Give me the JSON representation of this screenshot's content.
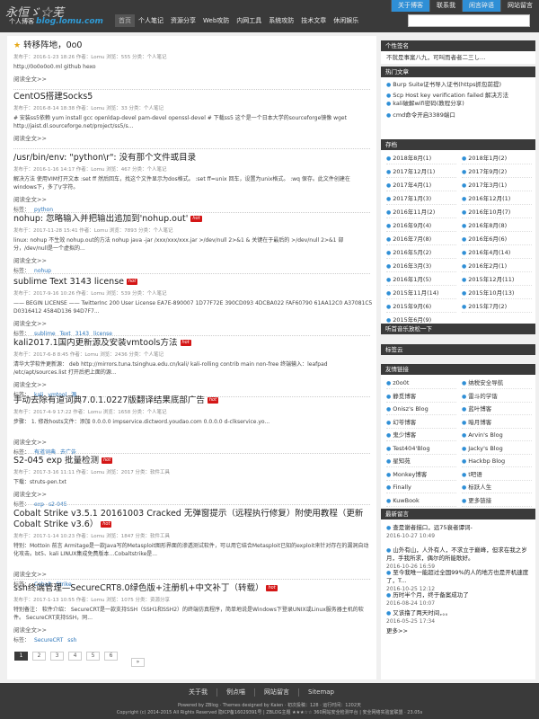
{
  "site": {
    "logo_main": "永恒ゞ☆芜",
    "logo_sub": "个人博客",
    "logo_domain": "blog.lomu.com"
  },
  "top_nav": [
    "关于博客",
    "联系我",
    "闲言碎语",
    "网站留言"
  ],
  "main_nav": [
    "首页",
    "个人笔记",
    "资源分享",
    "Web攻防",
    "内网工具",
    "系统攻防",
    "技术文章",
    "休闲娱乐"
  ],
  "search": {
    "placeholder": ""
  },
  "posts": [
    {
      "title": "转移阵地，0o0",
      "sticky": true,
      "hot": false,
      "meta": "发布于：2016-1-23 18:26  作者：Lomu  浏览：555  分类：个人笔记",
      "excerpt": "http://0o0o0o0.ml github          hexo",
      "more": "阅读全文>>",
      "tags": []
    },
    {
      "title": "CentOS搭建Socks5",
      "hot": false,
      "meta": "发布于：2016-8-14 18:38  作者：Lomu  浏览：33  分类：个人笔记",
      "excerpt": "# 安装ss5依赖 yum install gcc openldap-devel pam-devel openssl-devel # 下载ss5 这个是一个日本大学的sourceforge镜像 wget http://jaist.dl.sourceforge.net/project/ss5/s...",
      "more": "阅读全文>>",
      "tags": []
    },
    {
      "title": "/usr/bin/env: \"python\\r\": 没有那个文件或目录",
      "hot": false,
      "meta": "发布于：2016-1-16 14:17  作者：Lomu  浏览：467  分类：个人笔记",
      "excerpt": "解决方法 使用VIM打开文本  :set ff 然后回车，找这个文件显示为dos格式。  :set ff=unix 回车，设置为unix格式。  :wq 保存。此文件创建在windows下，多了\\r字符。",
      "more": "阅读全文>>",
      "tags": [
        "python"
      ]
    },
    {
      "title": "nohup: 忽略输入并把输出追加到'nohup.out'",
      "hot": true,
      "meta": "发布于：2017-11-28 15:41  作者：Lomu  浏览：7893  分类：个人笔记",
      "excerpt": "linux: nohup 不生效 nohup.out的方法 nohup java -jar /xxx/xxx/xxx.jar >/dev/null 2>&1 & 关键在于最后的 >/dev/null 2>&1 部分，/dev/null是一个虚拟的...",
      "more": "阅读全文>>",
      "tags": [
        "nohup"
      ]
    },
    {
      "title": "sublime Text 3143 license",
      "hot": true,
      "meta": "发布于：2017-9-16 10:26  作者：Lomu  浏览：539  分类：个人笔记",
      "excerpt": "—— BEGIN LICENSE —— TwitterInc 200 User License EA7E-890007 1D77F72E 390CD093 4DCBA022 FAF60790 61AA12C0 A37081C5 D0316412 4584D136 94D7F7...",
      "more": "阅读全文>>",
      "tags": [
        "sublime",
        "Text",
        "3143",
        "license"
      ]
    },
    {
      "title": "kali2017.1国内更新源及安装vmtools方法",
      "hot": true,
      "meta": "发布于：2017-6-8 8:45  作者：Lomu  浏览：2436  分类：个人笔记",
      "excerpt": "清华大学软件更新源： deb http://mirrors.tuna.tsinghua.edu.cn/kali/  kali-rolling contrib main non-free 终端输入：leafpad /etc/apt/sources.list 打开后把上面的源...",
      "more": "阅读全文>>",
      "tags": [
        "kali",
        "vmtool",
        "源"
      ]
    },
    {
      "title": "手动去除有道词典7.0.1.0227版翻译结果底部广告",
      "hot": true,
      "meta": "发布于：2017-4-9 17:22  作者：Lomu  浏览：1658  分类：个人笔记",
      "excerpt": "步骤： 1. 修改hosts文件：添加 0.0.0.0         impservice.dictword.youdao.com 0.0.0.0 d-clkservice.yo...",
      "more": "阅读全文>>",
      "tags": [
        "有道词典",
        "去广告"
      ]
    },
    {
      "title": "S2-045 exp 批量检测",
      "hot": true,
      "meta": "发布于：2017-3-16 11:11  作者：Lomu  浏览：2017  分类：软件工具",
      "excerpt": "下载：struts-pen.txt",
      "more": "阅读全文>>",
      "tags": [
        "exp",
        "s2-045"
      ]
    },
    {
      "title": "Cobalt Strike v3.5.1 20161003 Cracked 无弹窗提示（远程执行修复）附使用教程（更新Cobalt Strike v3.6）",
      "hot": true,
      "meta": "发布于：2017-1-14 10:23  作者：Lomu  浏览：1847  分类：软件工具",
      "excerpt": "特别：Mottoin 前言 Armitage是一款Java写的Metasploit图形界面的渗透测试软件，可以用它结合Metasploit已知的exploit来针对存在的漏洞自动化攻击。bt5、kali LINUX集成免费版本…Cobaltstrike是...",
      "more": "阅读全文>>",
      "tags": [
        "Cobalt",
        "Strike"
      ]
    },
    {
      "title": "ssh终端管理—SecureCRT8.0绿色版+注册机+中文补丁（转载）",
      "hot": true,
      "meta": "发布于：2017-1-13 10:55  作者：Lomu  浏览：1075  分类：资源分享",
      "excerpt": "特别备注：  软件介绍：        SecureCRT是一款支持SSH（SSH1和SSH2）的终端仿真程序，简单地说是Windows下登录UNIX或Linux服务器主机的软件。 SecureCRT支持SSH，同...",
      "more": "阅读全文>>",
      "tags": [
        "SecureCRT",
        "ssh"
      ]
    }
  ],
  "tag_label": "标签：",
  "pagination": {
    "pages": [
      "1",
      "2",
      "3",
      "4",
      "5",
      "6"
    ],
    "next": "»",
    "active": "1"
  },
  "sidebar": {
    "signature": {
      "title": "个性签名",
      "text": "不就是事案八九，可叫而者者二三し…"
    },
    "hot": {
      "title": "热门文章",
      "items": [
        "Burp Suite证书导入证书(https抓包前提)",
        "Scp Host key verification failed 解决方法",
        "kali破解wifi密码(教程分享)",
        "cmd命令开启3389端口"
      ]
    },
    "archive": {
      "title": "存档",
      "items": [
        "2018年8月(1)",
        "2018年1月(2)",
        "2017年12月(1)",
        "2017年9月(2)",
        "2017年4月(1)",
        "2017年3月(1)",
        "2017年1月(3)",
        "2016年12月(1)",
        "2016年11月(2)",
        "2016年10月(7)",
        "2016年9月(4)",
        "2016年8月(8)",
        "2016年7月(8)",
        "2016年6月(6)",
        "2016年5月(2)",
        "2016年4月(14)",
        "2016年3月(3)",
        "2016年2月(1)",
        "2016年1月(5)",
        "2015年12月(11)",
        "2015年11月(14)",
        "2015年10月(13)",
        "2015年9月(6)",
        "2015年7月(2)",
        "2015年6月(9)"
      ]
    },
    "music": {
      "title": "听首音乐放松一下"
    },
    "tags": {
      "title": "标签云"
    },
    "links": {
      "title": "友情链接",
      "items": [
        "z0o0t",
        "纳税安全导航",
        "静觅博客",
        "雷斗的学谐",
        "Onisz's Blog",
        "蓝叶博客",
        "幻苓博客",
        "暗月博客",
        "鬼少博客",
        "Arvin's Blog",
        "Test404'Blog",
        "Jacky's Blog",
        "星知苑",
        "Hackbp Blog",
        "Monkey博客",
        "t吧语",
        "Finally",
        "标跃人生",
        "KuwBook",
        "更多链接"
      ]
    },
    "recent": {
      "title": "最新留言",
      "items": [
        {
          "text": "查是谢者描口，远75衰者谭词-",
          "date": "2016-10-27 10:49"
        },
        {
          "text": "山外有山，人外有人，不求立于巅峰，但求在我之岁月，手我所求，偶尔的所能歌好。",
          "date": "2016-10-26 16:59"
        },
        {
          "text": "至今我唯一能超过全国99%的人的地方也是开机速度了，T...",
          "date": "2016-10-25 12:12"
        },
        {
          "text": "历时半个月，终于备案成功了",
          "date": "2016-08-24 10:07"
        },
        {
          "text": "又该撸了两天时间，。。",
          "date": "2016-05-25 17:34"
        }
      ],
      "more": "更多>>"
    }
  },
  "footer": {
    "nav": [
      "关于我",
      "例点喵",
      "网站留言",
      "Sitemap"
    ],
    "line1": "Powered by ZBlog · Themes designed by Kaien · 初次投稿：128 · 运行时间：1202天",
    "line2": "Copyright (c) 2014-2015 All Rights Reserved 隐ICP备16029391号 | ZBLOG主题 ★★★☆☆ 360网站安全检测平台 | 安全网络实验室联盟 · 23.05s"
  }
}
